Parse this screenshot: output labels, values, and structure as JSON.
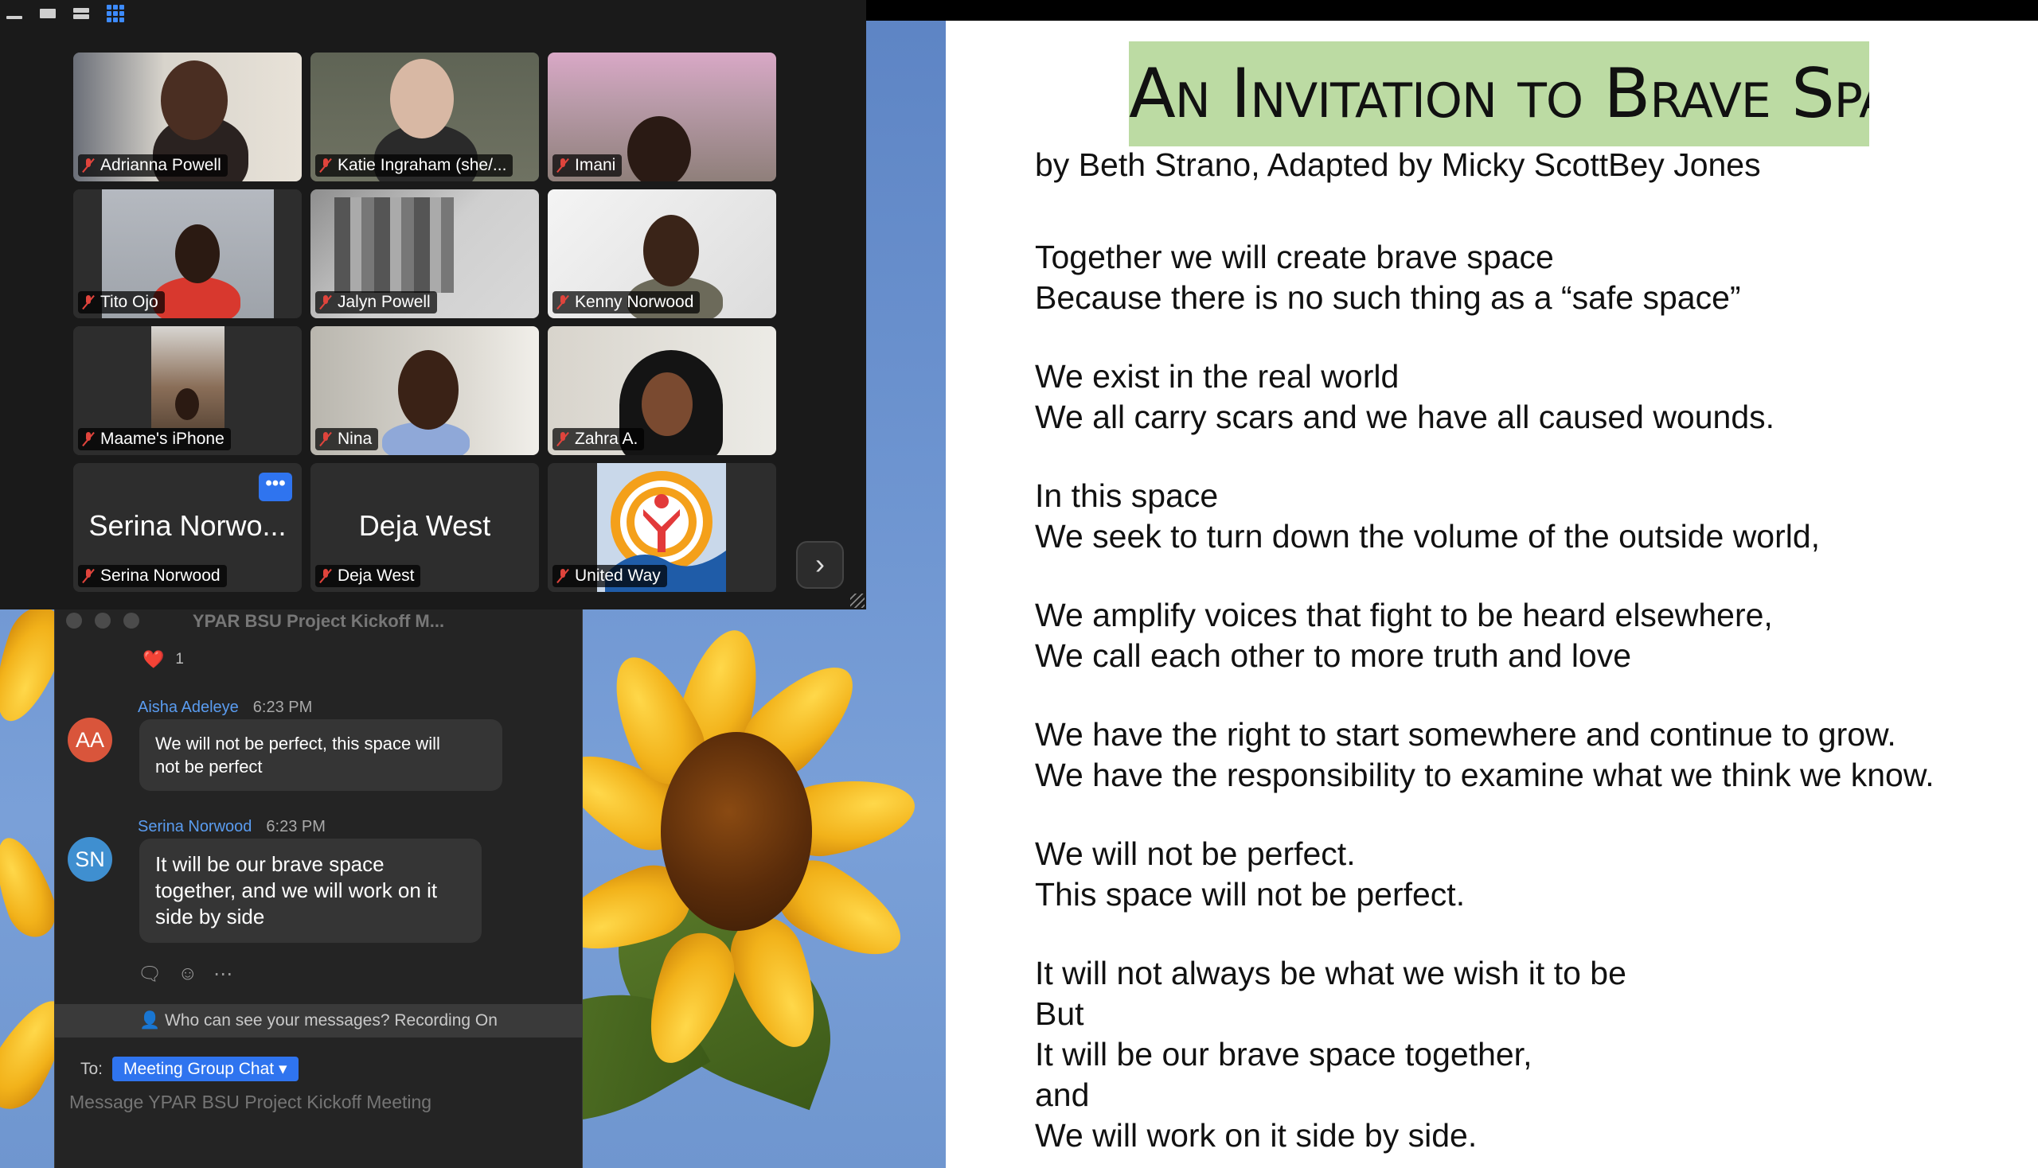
{
  "gallery": {
    "participants": [
      {
        "name": "Adrianna Powell"
      },
      {
        "name": "Katie Ingraham (she/..."
      },
      {
        "name": "Imani"
      },
      {
        "name": "Tito Ojo"
      },
      {
        "name": "Jalyn Powell"
      },
      {
        "name": "Kenny Norwood"
      },
      {
        "name": "Maame's iPhone"
      },
      {
        "name": "Nina"
      },
      {
        "name": "Zahra A."
      },
      {
        "name": "Serina Norwood",
        "display": "Serina Norwo..."
      },
      {
        "name": "Deja West",
        "display": "Deja West"
      },
      {
        "name": "United Way"
      }
    ],
    "more_label": "•••",
    "next_label": "›",
    "view_icons": [
      "speaker-view-icon",
      "thumbnail-view-icon",
      "split-view-icon",
      "gallery-grid-icon"
    ]
  },
  "chat": {
    "title": "YPAR BSU Project Kickoff M...",
    "reaction": {
      "emoji": "❤️",
      "count": "1"
    },
    "messages": [
      {
        "initials": "AA",
        "sender": "Aisha Adeleye",
        "time": "6:23 PM",
        "lines": [
          "We will not be perfect, this space will",
          "not be perfect"
        ],
        "avatar_color": "#d9553b"
      },
      {
        "initials": "SN",
        "sender": "Serina Norwood",
        "time": "6:23 PM",
        "lines": [
          "It will be our brave space",
          "together, and we will work on it",
          "side by side"
        ],
        "avatar_color": "#3f8fd0"
      }
    ],
    "visibility": "Who can see your messages? Recording On",
    "to_label": "To:",
    "to_value": "Meeting Group Chat ▾",
    "input_placeholder": "Message YPAR BSU Project Kickoff Meeting"
  },
  "slide": {
    "title": "An Invitation to Brave Space",
    "byline": "by Beth Strano, Adapted by Micky ScottBey Jones",
    "stanzas": [
      [
        "Together we will create brave space",
        "Because there is no such thing as a “safe space”"
      ],
      [
        "We exist in the real world",
        "We all carry scars and we have all caused wounds."
      ],
      [
        "In this space",
        "We seek to turn down the volume of the outside world,"
      ],
      [
        "We amplify voices that fight to be heard elsewhere,",
        "We call each other to more truth and love"
      ],
      [
        "We have the right to start somewhere and continue to grow.",
        "We have the responsibility to examine what we think we know."
      ],
      [
        "We will not be perfect.",
        "This space will not be perfect."
      ],
      [
        "It will not always be what we wish it to be",
        "But",
        "It will be our brave space together,",
        "and",
        "We will work on it side by side."
      ]
    ],
    "title_bg": "#bcdba3"
  }
}
